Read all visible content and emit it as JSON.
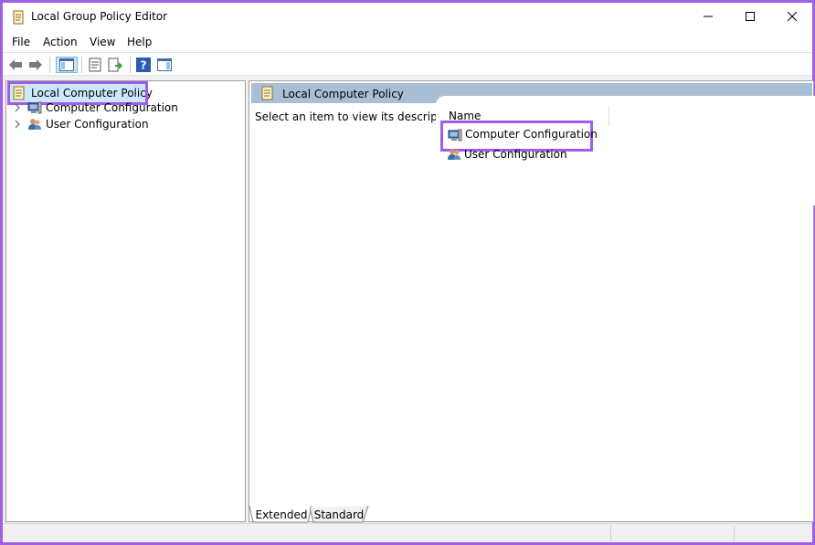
{
  "window": {
    "title": "Local Group Policy Editor",
    "title_icon": "policy-scroll-icon"
  },
  "menu": [
    "File",
    "Action",
    "View",
    "Help"
  ],
  "toolbar": {
    "buttons": [
      "back-arrow-icon",
      "forward-arrow-icon",
      "show-hide-console-tree-icon",
      "properties-icon",
      "export-list-icon",
      "help-icon",
      "show-hide-action-pane-icon"
    ]
  },
  "tree": {
    "root": "Local Computer Policy",
    "children": [
      "Computer Configuration",
      "User Configuration"
    ]
  },
  "details": {
    "header": "Local Computer Policy",
    "description": "Select an item to view its description.",
    "column_name": "Name",
    "items": [
      "Computer Configuration",
      "User Configuration"
    ]
  },
  "tabs": [
    "Extended",
    "Standard"
  ],
  "colors": {
    "highlight_outline": "#a05ee6",
    "selected_bg": "#cce8ff",
    "header_bg": "#a9bfd6"
  }
}
